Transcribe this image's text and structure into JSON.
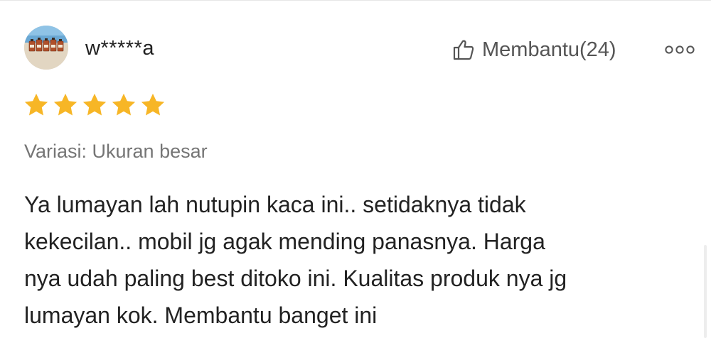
{
  "review": {
    "user": {
      "name": "w*****a",
      "avatar_icon": "avatar-photo-bottles-on-beach"
    },
    "helpful": {
      "icon": "thumbs-up-icon",
      "label": "Membantu(24)"
    },
    "more_icon": "more-options-icon",
    "rating": {
      "stars": 5,
      "max": 5,
      "color": "#f7b626"
    },
    "variation": "Variasi: Ukuran besar",
    "text": "Ya lumayan lah nutupin kaca ini.. setidaknya tidak\nkekecilan.. mobil jg agak mending panasnya. Harga\nnya udah paling best ditoko ini. Kualitas produk nya jg\nlumayan kok. Membantu banget ini"
  }
}
